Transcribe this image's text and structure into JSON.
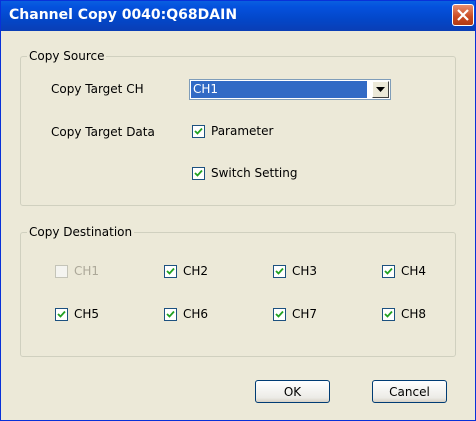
{
  "window": {
    "title": "Channel Copy 0040:Q68DAIN"
  },
  "source": {
    "legend": "Copy Source",
    "target_ch_label": "Copy Target CH",
    "target_ch_value": "CH1",
    "target_data_label": "Copy Target Data",
    "parameter": {
      "label": "Parameter",
      "checked": true
    },
    "switch_setting": {
      "label": "Switch Setting",
      "checked": true
    }
  },
  "destination": {
    "legend": "Copy Destination",
    "channels": [
      {
        "label": "CH1",
        "checked": false,
        "disabled": true
      },
      {
        "label": "CH2",
        "checked": true,
        "disabled": false
      },
      {
        "label": "CH3",
        "checked": true,
        "disabled": false
      },
      {
        "label": "CH4",
        "checked": true,
        "disabled": false
      },
      {
        "label": "CH5",
        "checked": true,
        "disabled": false
      },
      {
        "label": "CH6",
        "checked": true,
        "disabled": false
      },
      {
        "label": "CH7",
        "checked": true,
        "disabled": false
      },
      {
        "label": "CH8",
        "checked": true,
        "disabled": false
      }
    ]
  },
  "buttons": {
    "ok": "OK",
    "cancel": "Cancel"
  },
  "icons": {
    "close": "close-icon",
    "dropdown": "chevron-down-icon",
    "check": "checkmark-icon"
  }
}
